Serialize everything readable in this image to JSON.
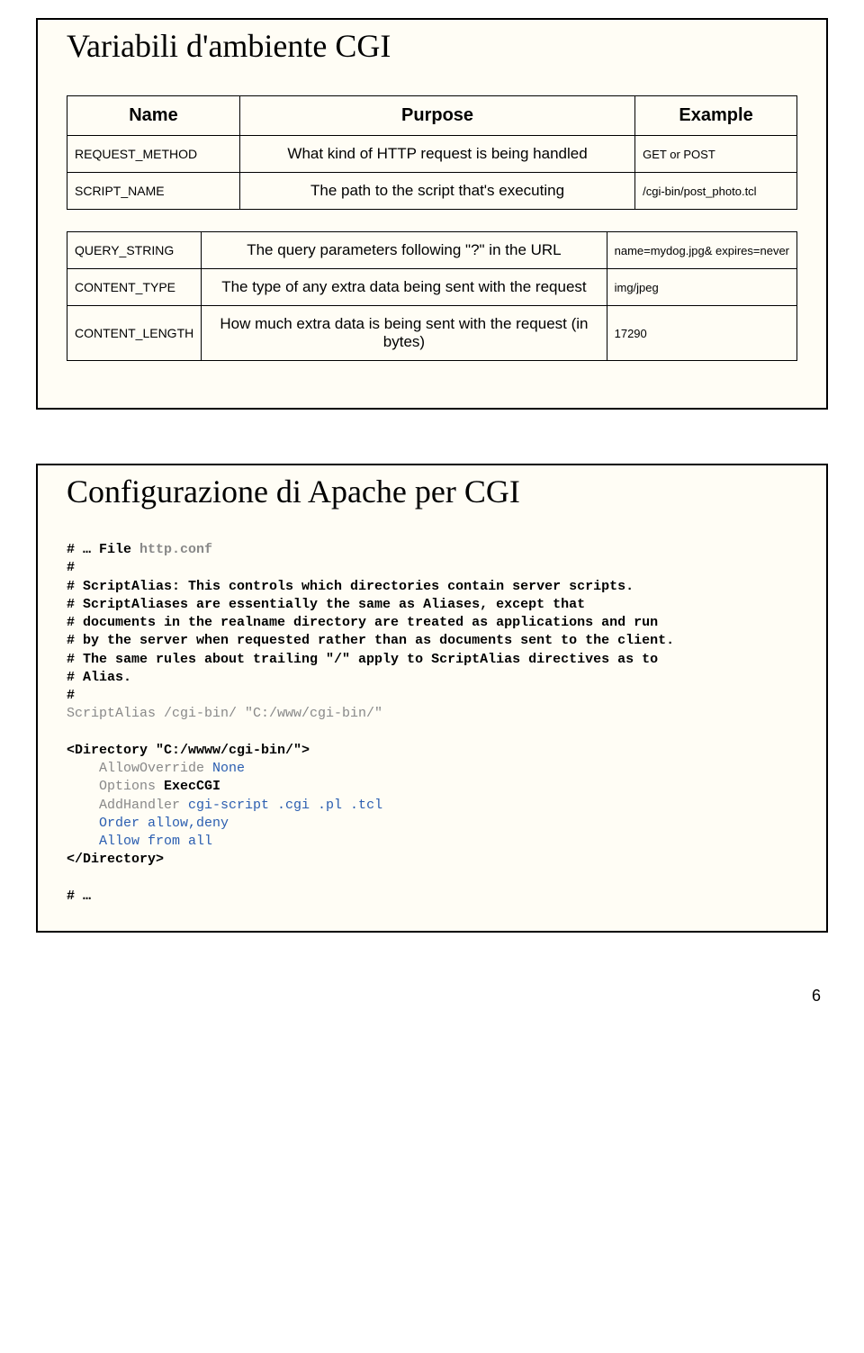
{
  "slide1": {
    "title": "Variabili d'ambiente CGI",
    "headers": {
      "c1": "Name",
      "c2": "Purpose",
      "c3": "Example"
    },
    "group1": [
      {
        "name": "REQUEST_METHOD",
        "purpose": "What kind of HTTP request is being handled",
        "example": "GET or POST"
      },
      {
        "name": "SCRIPT_NAME",
        "purpose": "The path to the script that's executing",
        "example": "/cgi-bin/post_photo.tcl"
      }
    ],
    "group2": [
      {
        "name": "QUERY_STRING",
        "purpose": "The query parameters following \"?\" in the URL",
        "example": "name=mydog.jpg& expires=never"
      },
      {
        "name": "CONTENT_TYPE",
        "purpose": "The type of any extra data being sent with the request",
        "example": "img/jpeg"
      },
      {
        "name": "CONTENT_LENGTH",
        "purpose": "How much extra data is being sent with the request (in bytes)",
        "example": "17290"
      }
    ]
  },
  "slide2": {
    "title": "Configurazione di Apache per CGI",
    "code": {
      "l1": "# … File ",
      "l1b": "http.conf",
      "l2": "#",
      "l3": "# ScriptAlias: This controls which directories contain server scripts.",
      "l4": "# ScriptAliases are essentially the same as Aliases, except that",
      "l5": "# documents in the realname directory are treated as applications and run",
      "l6": "# by the server when requested rather than as documents sent to the client.",
      "l7": "# The same rules about trailing \"/\" apply to ScriptAlias directives as to",
      "l8": "# Alias.",
      "l9": "#",
      "l10": "ScriptAlias /cgi-bin/ \"C:/www/cgi-bin/\"",
      "l12": "<Directory \"C:/wwww/cgi-bin/\">",
      "l13a": "    AllowOverride ",
      "l13b": "None",
      "l14a": "    Options ",
      "l14b": "ExecCGI",
      "l15a": "    AddHandler ",
      "l15b": "cgi-script .cgi .pl .tcl",
      "l16": "    Order allow,deny",
      "l17": "    Allow from all",
      "l18": "</Directory>",
      "l20": "# …"
    }
  },
  "pageNumber": "6"
}
